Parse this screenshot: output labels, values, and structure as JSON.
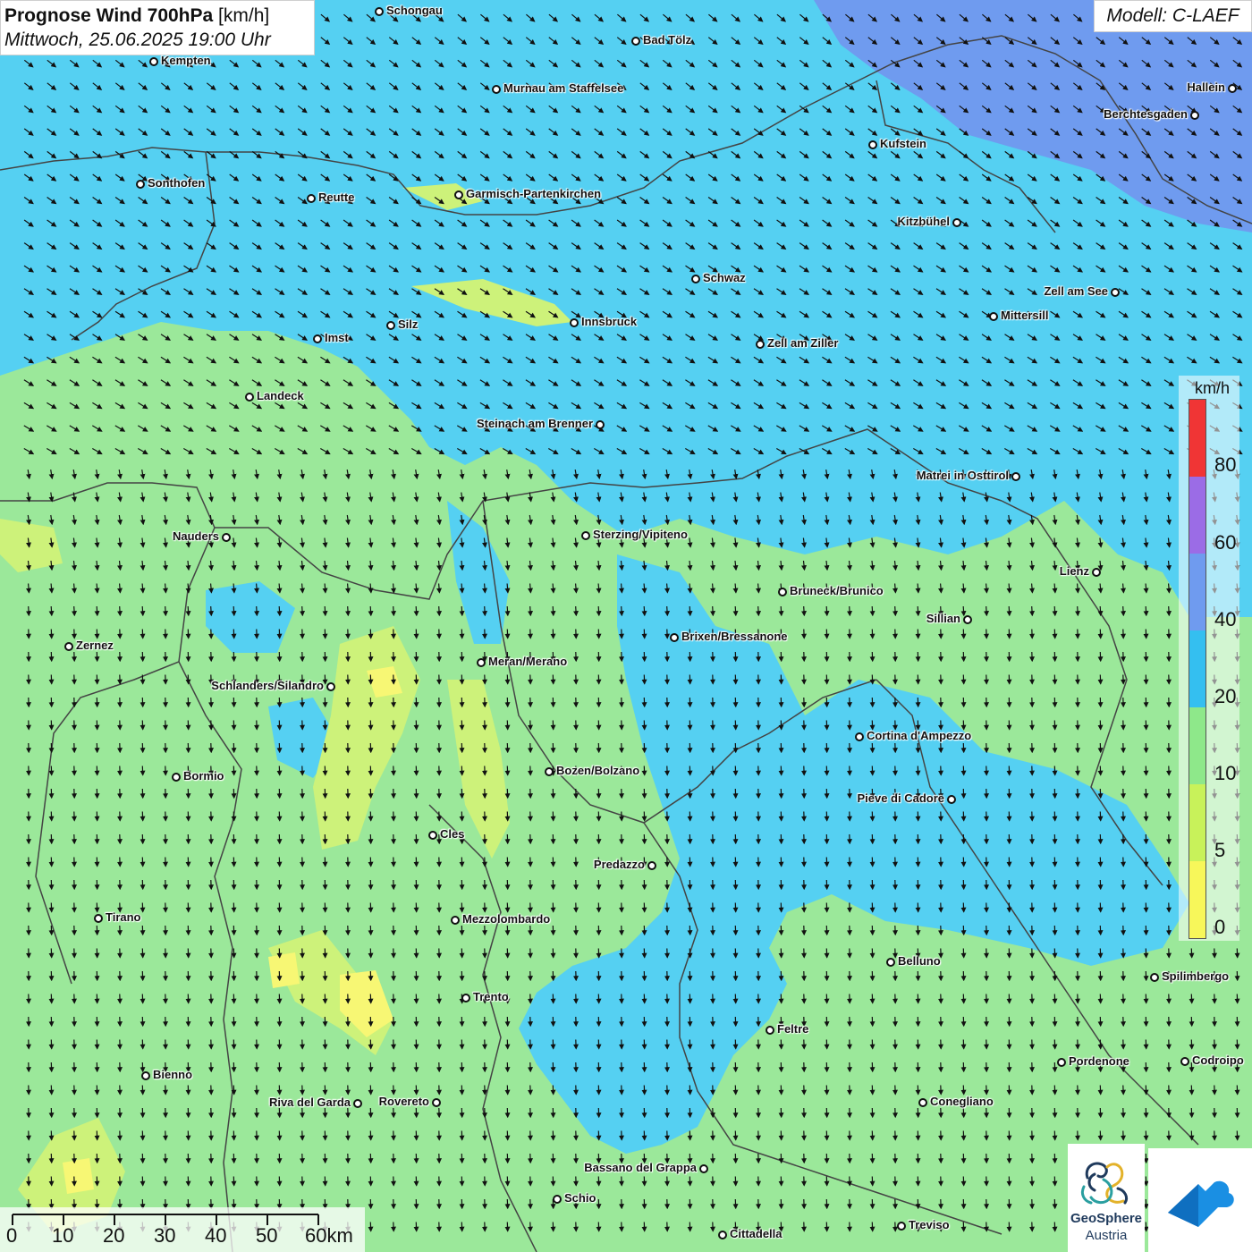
{
  "header": {
    "title_bold": "Prognose Wind 700hPa",
    "title_unit": "[km/h]",
    "datetime": "Mittwoch, 25.06.2025 19:00 Uhr"
  },
  "model": {
    "label": "Modell: C-LAEF"
  },
  "colors": {
    "wind_0_5": "#f7f774",
    "wind_5_10": "#cdf27a",
    "wind_10_20": "#9be89a",
    "wind_20_40": "#55d0f2",
    "wind_40_60": "#6f9bef",
    "wind_60_80": "#9b6ce6",
    "wind_80_plus": "#f03535",
    "arrow": "#111111",
    "border_line": "#444444"
  },
  "legend": {
    "unit": "km/h",
    "ticks": [
      "0",
      "5",
      "10",
      "20",
      "40",
      "60",
      "80"
    ]
  },
  "scale": {
    "labels": [
      "0",
      "10",
      "20",
      "30",
      "40",
      "50",
      "60km"
    ]
  },
  "logos": {
    "geosphere_name": "GeoSphere",
    "geosphere_sub": "Austria",
    "geosphere_icon": "geosphere-logo-icon",
    "app_icon": "cloud-arrow-app-icon"
  },
  "cities": [
    {
      "name": "Schongau",
      "side": "right"
    },
    {
      "name": "Bad Tölz",
      "side": "right"
    },
    {
      "name": "Kempten",
      "side": "right"
    },
    {
      "name": "Murnau am Staffelsee",
      "side": "right"
    },
    {
      "name": "Hallein",
      "side": "left"
    },
    {
      "name": "Berchtesgaden",
      "side": "left"
    },
    {
      "name": "Kufstein",
      "side": "right"
    },
    {
      "name": "Sonthofen",
      "side": "right"
    },
    {
      "name": "Reutte",
      "side": "right"
    },
    {
      "name": "Garmisch-Partenkirchen",
      "side": "right"
    },
    {
      "name": "Kitzbühel",
      "side": "left"
    },
    {
      "name": "Schwaz",
      "side": "right"
    },
    {
      "name": "Zell am See",
      "side": "left"
    },
    {
      "name": "Mittersill",
      "side": "right"
    },
    {
      "name": "Innsbruck",
      "side": "right"
    },
    {
      "name": "Silz",
      "side": "right"
    },
    {
      "name": "Imst",
      "side": "right"
    },
    {
      "name": "Zell am Ziller",
      "side": "right"
    },
    {
      "name": "Landeck",
      "side": "right"
    },
    {
      "name": "Steinach am Brenner",
      "side": "left"
    },
    {
      "name": "Matrei in Osttirol",
      "side": "left"
    },
    {
      "name": "Nauders",
      "side": "left"
    },
    {
      "name": "Sterzing/Vipiteno",
      "side": "right"
    },
    {
      "name": "Lienz",
      "side": "left"
    },
    {
      "name": "Bruneck/Brunico",
      "side": "right"
    },
    {
      "name": "Sillian",
      "side": "left"
    },
    {
      "name": "Brixen/Bressanone",
      "side": "right"
    },
    {
      "name": "Zernez",
      "side": "right"
    },
    {
      "name": "Meran/Merano",
      "side": "right"
    },
    {
      "name": "Schlanders/Silandro",
      "side": "left"
    },
    {
      "name": "Cortina d'Ampezzo",
      "side": "right"
    },
    {
      "name": "Bozen/Bolzano",
      "side": "right"
    },
    {
      "name": "Bormio",
      "side": "right"
    },
    {
      "name": "Pieve di Cadore",
      "side": "left"
    },
    {
      "name": "Cles",
      "side": "right"
    },
    {
      "name": "Predazzo",
      "side": "left"
    },
    {
      "name": "Tirano",
      "side": "right"
    },
    {
      "name": "Mezzolombardo",
      "side": "right"
    },
    {
      "name": "Belluno",
      "side": "right"
    },
    {
      "name": "Spilimbergo",
      "side": "right"
    },
    {
      "name": "Trento",
      "side": "right"
    },
    {
      "name": "Feltre",
      "side": "right"
    },
    {
      "name": "Pordenone",
      "side": "right"
    },
    {
      "name": "Codroipo",
      "side": "right"
    },
    {
      "name": "Bienno",
      "side": "right"
    },
    {
      "name": "Riva del Garda",
      "side": "left"
    },
    {
      "name": "Rovereto",
      "side": "left"
    },
    {
      "name": "Conegliano",
      "side": "right"
    },
    {
      "name": "Bassano del Grappa",
      "side": "left"
    },
    {
      "name": "Schio",
      "side": "right"
    },
    {
      "name": "Cittadella",
      "side": "right"
    },
    {
      "name": "Treviso",
      "side": "right"
    }
  ]
}
